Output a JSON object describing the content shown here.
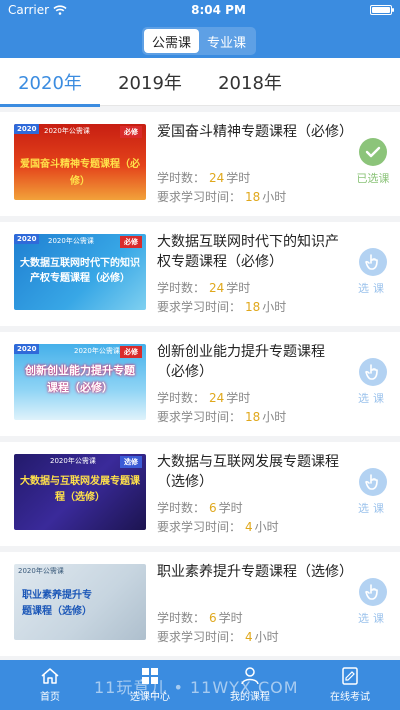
{
  "status_bar": {
    "carrier": "Carrier",
    "time": "8:04 PM"
  },
  "segment": {
    "tabs": [
      {
        "label": "公需课"
      },
      {
        "label": "专业课"
      }
    ],
    "active": 0
  },
  "year_tabs": [
    {
      "label": "2020年"
    },
    {
      "label": "2019年"
    },
    {
      "label": "2018年"
    }
  ],
  "courses": [
    {
      "thumb": {
        "year": "2020",
        "badge": "必修",
        "subtitle": "2020年公需课",
        "text": "爱国奋斗精神专题课程（必修）"
      },
      "title": "爱国奋斗精神专题课程（必修）",
      "hours_label": "学时数：",
      "hours": "24",
      "hours_unit": "学时",
      "req_label": "要求学习时间：",
      "req": "18",
      "req_unit": "小时",
      "action": "已选课"
    },
    {
      "thumb": {
        "year": "2020",
        "badge": "必修",
        "subtitle": "2020年公需课",
        "text": "大数据互联网时代下的知识产权专题课程（必修）"
      },
      "title": "大数据互联网时代下的知识产权专题课程（必修）",
      "hours_label": "学时数：",
      "hours": "24",
      "hours_unit": "学时",
      "req_label": "要求学习时间：",
      "req": "18",
      "req_unit": "小时",
      "action": "选课"
    },
    {
      "thumb": {
        "year": "2020",
        "badge": "必修",
        "subtitle": "2020年公需课",
        "text": "创新创业能力提升专题课程（必修）"
      },
      "title": "创新创业能力提升专题课程（必修）",
      "hours_label": "学时数：",
      "hours": "24",
      "hours_unit": "学时",
      "req_label": "要求学习时间：",
      "req": "18",
      "req_unit": "小时",
      "action": "选课"
    },
    {
      "thumb": {
        "year": "",
        "badge": "选修",
        "subtitle": "2020年公需课",
        "text": "大数据与互联网发展专题课程（选修）"
      },
      "title": "大数据与互联网发展专题课程（选修）",
      "hours_label": "学时数：",
      "hours": "6",
      "hours_unit": "学时",
      "req_label": "要求学习时间：",
      "req": "4",
      "req_unit": "小时",
      "action": "选课"
    },
    {
      "thumb": {
        "year": "",
        "badge": "选修",
        "subtitle": "2020年公需课",
        "text": "职业素养提升专题课程（选修）"
      },
      "title": "职业素养提升专题课程（选修）",
      "hours_label": "学时数：",
      "hours": "6",
      "hours_unit": "学时",
      "req_label": "要求学习时间：",
      "req": "4",
      "req_unit": "小时",
      "action": "选课"
    }
  ],
  "bottom_nav": [
    {
      "label": "首页",
      "icon": "home-icon"
    },
    {
      "label": "选课中心",
      "icon": "grid-icon"
    },
    {
      "label": "我的课程",
      "icon": "user-icon"
    },
    {
      "label": "在线考试",
      "icon": "exam-icon"
    }
  ],
  "watermark": "11玩意儿 • 11WYX.COM",
  "colors": {
    "brand": "#3b8ce0",
    "accent_number": "#e0a81c",
    "selected": "#8cc47a",
    "selectable": "#b3d2f2"
  }
}
